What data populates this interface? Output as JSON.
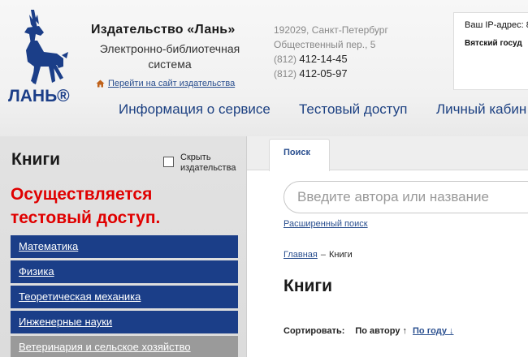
{
  "header": {
    "logo_text": "ЛАНЬ®",
    "publisher_title": "Издательство «Лань»",
    "publisher_subtitle": "Электронно-библиотечная система",
    "publisher_link": "Перейти на сайт издательства",
    "address_line1": "192029, Санкт-Петербург",
    "address_line2": "Общественный пер., 5",
    "phone1_code": "(812)",
    "phone1_number": "412-14-45",
    "phone2_code": "(812)",
    "phone2_number": "412-05-97",
    "ip_label": "Ваш IP-адрес: 8",
    "org_name": "Вятский госуд",
    "home_icon": "home-icon"
  },
  "nav": {
    "items": [
      {
        "label": "Информация о сервисе"
      },
      {
        "label": "Тестовый доступ"
      },
      {
        "label": "Личный кабин"
      }
    ]
  },
  "sidebar": {
    "heading": "Книги",
    "hide_publishers_label": "Скрыть издательства",
    "hide_publishers_checked": false,
    "notice": "Осуществляется тестовый доступ.",
    "categories": [
      {
        "label": "Математика"
      },
      {
        "label": "Физика"
      },
      {
        "label": "Теоретическая механика"
      },
      {
        "label": "Инженерные науки"
      },
      {
        "label": "Ветеринария и сельское хозяйство"
      }
    ]
  },
  "content": {
    "tab_label": "Поиск",
    "search_placeholder": "Введите автора или название",
    "advanced_search": "Расширенный поиск",
    "breadcrumb_home": "Главная",
    "breadcrumb_sep": "–",
    "breadcrumb_current": "Книги",
    "page_title": "Книги",
    "sort_label": "Сортировать:",
    "sort_author": "По автору ↑",
    "sort_year": "По году ↓"
  },
  "colors": {
    "nav_text": "#1d4182",
    "category_bg": "#1b3e88",
    "category_active_bg": "#9a9a9a",
    "notice_red": "#e00000",
    "link_blue": "#2a4f8f"
  }
}
